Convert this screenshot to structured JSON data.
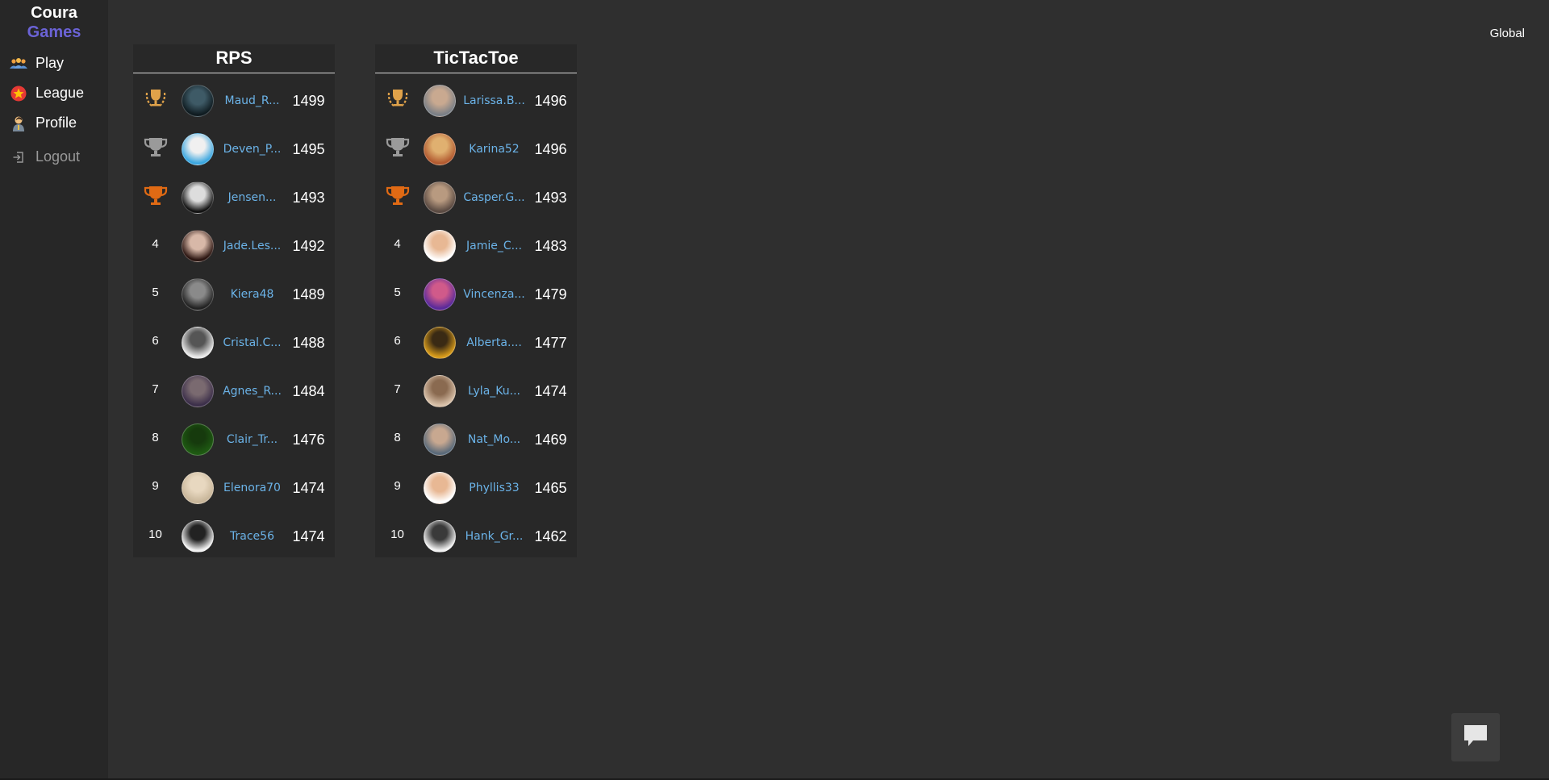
{
  "brand": {
    "line1": "Coura",
    "line2": "Games"
  },
  "nav": {
    "play": "Play",
    "league": "League",
    "profile": "Profile",
    "logout": "Logout"
  },
  "scope_label": "Global",
  "boards": [
    {
      "title": "RPS",
      "rows": [
        {
          "rank": "1",
          "medal": "gold",
          "name": "Maud_R...",
          "score": "1499",
          "avatar": [
            "#0f1b20",
            "#3e5a66"
          ]
        },
        {
          "rank": "2",
          "medal": "silver",
          "name": "Deven_P...",
          "score": "1495",
          "avatar": [
            "#3ba7e0",
            "#f0f0f0"
          ]
        },
        {
          "rank": "3",
          "medal": "bronze",
          "name": "Jensen...",
          "score": "1493",
          "avatar": [
            "#111111",
            "#dddddd"
          ]
        },
        {
          "rank": "4",
          "medal": "",
          "name": "Jade.Les...",
          "score": "1492",
          "avatar": [
            "#2a1410",
            "#d8b8a8"
          ]
        },
        {
          "rank": "5",
          "medal": "",
          "name": "Kiera48",
          "score": "1489",
          "avatar": [
            "#222222",
            "#8a8a8a"
          ]
        },
        {
          "rank": "6",
          "medal": "",
          "name": "Cristal.C...",
          "score": "1488",
          "avatar": [
            "#e8e8e8",
            "#555555"
          ]
        },
        {
          "rank": "7",
          "medal": "",
          "name": "Agnes_R...",
          "score": "1484",
          "avatar": [
            "#3c2f4a",
            "#7a6a70"
          ]
        },
        {
          "rank": "8",
          "medal": "",
          "name": "Clair_Tr...",
          "score": "1476",
          "avatar": [
            "#1e5a12",
            "#163a0d"
          ]
        },
        {
          "rank": "9",
          "medal": "",
          "name": "Elenora70",
          "score": "1474",
          "avatar": [
            "#c8b69a",
            "#e8d8c0"
          ]
        },
        {
          "rank": "10",
          "medal": "",
          "name": "Trace56",
          "score": "1474",
          "avatar": [
            "#f2f2f2",
            "#222222"
          ]
        }
      ]
    },
    {
      "title": "TicTacToe",
      "rows": [
        {
          "rank": "1",
          "medal": "gold",
          "name": "Larissa.B...",
          "score": "1496",
          "avatar": [
            "#7a7f86",
            "#c9a990"
          ]
        },
        {
          "rank": "2",
          "medal": "silver",
          "name": "Karina52",
          "score": "1496",
          "avatar": [
            "#b25a30",
            "#e0b070"
          ]
        },
        {
          "rank": "3",
          "medal": "bronze",
          "name": "Casper.G...",
          "score": "1493",
          "avatar": [
            "#5a4a42",
            "#b89a80"
          ]
        },
        {
          "rank": "4",
          "medal": "",
          "name": "Jamie_C...",
          "score": "1483",
          "avatar": [
            "#ffffff",
            "#e8b894"
          ]
        },
        {
          "rank": "5",
          "medal": "",
          "name": "Vincenza...",
          "score": "1479",
          "avatar": [
            "#5a2a9a",
            "#d05a8a"
          ]
        },
        {
          "rank": "6",
          "medal": "",
          "name": "Alberta....",
          "score": "1477",
          "avatar": [
            "#d69a1a",
            "#3a2a14"
          ]
        },
        {
          "rank": "7",
          "medal": "",
          "name": "Lyla_Ku...",
          "score": "1474",
          "avatar": [
            "#d8c0a8",
            "#8a6a50"
          ]
        },
        {
          "rank": "8",
          "medal": "",
          "name": "Nat_Mo...",
          "score": "1469",
          "avatar": [
            "#5a6a7a",
            "#c8a890"
          ]
        },
        {
          "rank": "9",
          "medal": "",
          "name": "Phyllis33",
          "score": "1465",
          "avatar": [
            "#ffffff",
            "#e8b894"
          ]
        },
        {
          "rank": "10",
          "medal": "",
          "name": "Hank_Gr...",
          "score": "1462",
          "avatar": [
            "#f2f2f2",
            "#3a3a3a"
          ]
        }
      ]
    }
  ],
  "icons": {
    "play": "players-icon",
    "league": "league-star-icon",
    "profile": "profile-person-icon",
    "logout": "logout-icon",
    "chat": "chat-bubble-icon",
    "gold": "gold-laurel-trophy-icon",
    "silver": "silver-trophy-icon",
    "bronze": "bronze-trophy-icon"
  },
  "colors": {
    "background": "#2f2f2f",
    "sidebar": "#272727",
    "board": "#282828",
    "accent": "#6b63d6",
    "username": "#6bb3e8",
    "gold": "#e0a24a",
    "silver": "#9a9a9a",
    "bronze": "#e06a14"
  }
}
